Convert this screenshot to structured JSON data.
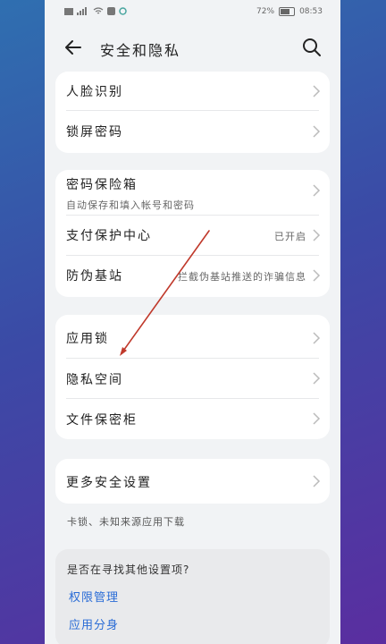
{
  "status_bar": {
    "battery": "72%",
    "time": "08:53"
  },
  "header": {
    "title": "安全和隐私"
  },
  "card1": {
    "items": [
      {
        "label": "人脸识别"
      },
      {
        "label": "锁屏密码"
      }
    ]
  },
  "card2": {
    "items": [
      {
        "label": "密码保险箱",
        "sub": "自动保存和填入帐号和密码"
      },
      {
        "label": "支付保护中心",
        "value": "已开启"
      },
      {
        "label": "防伪基站",
        "value": "拦截伪基站推送的诈骗信息"
      }
    ]
  },
  "card3": {
    "items": [
      {
        "label": "应用锁"
      },
      {
        "label": "隐私空间"
      },
      {
        "label": "文件保密柜"
      }
    ]
  },
  "card4": {
    "label": "更多安全设置",
    "footnote": "卡锁、未知来源应用下载"
  },
  "suggestion": {
    "question": "是否在寻找其他设置项?",
    "links": [
      "权限管理",
      "应用分身"
    ]
  },
  "colors": {
    "link": "#2a6cd6",
    "arrow": "#c0392b"
  }
}
